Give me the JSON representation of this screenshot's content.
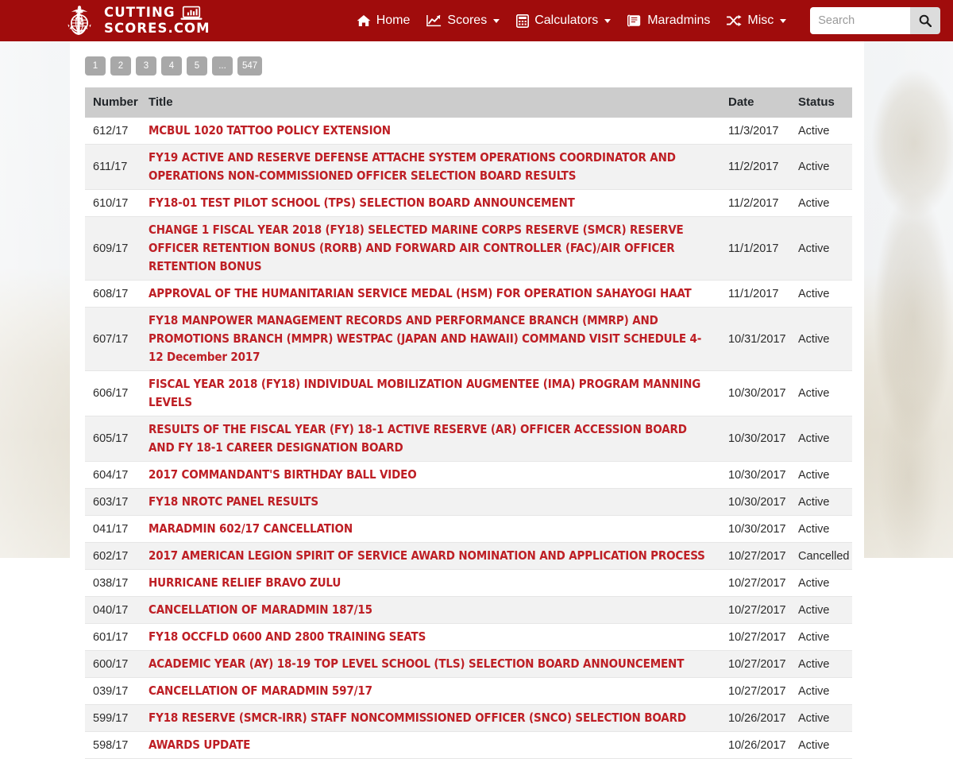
{
  "brand": {
    "line1": "CUTTING",
    "line2": "SCORES.COM",
    "emblem_icon": "marine-corps-ega-icon",
    "laptop_icon": "laptop-chart-icon"
  },
  "nav": {
    "items": [
      {
        "label": "Home",
        "icon": "home-icon",
        "caret": false
      },
      {
        "label": "Scores",
        "icon": "chart-line-icon",
        "caret": true
      },
      {
        "label": "Calculators",
        "icon": "calculator-icon",
        "caret": true
      },
      {
        "label": "Maradmins",
        "icon": "book-icon",
        "caret": false
      },
      {
        "label": "Misc",
        "icon": "shuffle-icon",
        "caret": true
      }
    ]
  },
  "search": {
    "placeholder": "Search",
    "value": "",
    "button_icon": "search-icon"
  },
  "pagination": {
    "pages": [
      "1",
      "2",
      "3",
      "4",
      "5",
      "...",
      "547"
    ],
    "active": "1"
  },
  "colors": {
    "header_red": "#a00c0c",
    "link_red": "#be1f25",
    "table_header_gray": "#cccccc",
    "pagination_gray": "#a8a8a8",
    "row_alt_gray": "#f2f2f2"
  },
  "table": {
    "columns": [
      "Number",
      "Title",
      "Date",
      "Status"
    ],
    "rows": [
      {
        "number": "612/17",
        "title": "MCBUL 1020 TATTOO POLICY EXTENSION",
        "date": "11/3/2017",
        "status": "Active"
      },
      {
        "number": "611/17",
        "title": "FY19 ACTIVE AND RESERVE DEFENSE ATTACHE SYSTEM OPERATIONS COORDINATOR AND OPERATIONS NON-COMMISSIONED OFFICER SELECTION BOARD RESULTS",
        "date": "11/2/2017",
        "status": "Active"
      },
      {
        "number": "610/17",
        "title": "FY18-01 TEST PILOT SCHOOL (TPS) SELECTION BOARD ANNOUNCEMENT",
        "date": "11/2/2017",
        "status": "Active"
      },
      {
        "number": "609/17",
        "title": "CHANGE 1 FISCAL YEAR 2018 (FY18) SELECTED MARINE CORPS RESERVE (SMCR) RESERVE OFFICER RETENTION BONUS (RORB) AND FORWARD AIR CONTROLLER (FAC)/AIR OFFICER RETENTION BONUS",
        "date": "11/1/2017",
        "status": "Active"
      },
      {
        "number": "608/17",
        "title": "APPROVAL OF THE HUMANITARIAN SERVICE MEDAL (HSM) FOR OPERATION SAHAYOGI HAAT",
        "date": "11/1/2017",
        "status": "Active"
      },
      {
        "number": "607/17",
        "title": "FY18 MANPOWER MANAGEMENT RECORDS AND PERFORMANCE BRANCH (MMRP) AND PROMOTIONS BRANCH (MMPR) WESTPAC (JAPAN AND HAWAII) COMMAND VISIT SCHEDULE 4-12 December 2017",
        "date": "10/31/2017",
        "status": "Active"
      },
      {
        "number": "606/17",
        "title": "FISCAL YEAR 2018 (FY18) INDIVIDUAL MOBILIZATION AUGMENTEE (IMA) PROGRAM MANNING LEVELS",
        "date": "10/30/2017",
        "status": "Active"
      },
      {
        "number": "605/17",
        "title": "RESULTS OF THE FISCAL YEAR (FY) 18-1 ACTIVE RESERVE (AR) OFFICER ACCESSION BOARD AND FY 18-1 CAREER DESIGNATION BOARD",
        "date": "10/30/2017",
        "status": "Active"
      },
      {
        "number": "604/17",
        "title": "2017 COMMANDANT'S BIRTHDAY BALL VIDEO",
        "date": "10/30/2017",
        "status": "Active"
      },
      {
        "number": "603/17",
        "title": "FY18 NROTC PANEL RESULTS",
        "date": "10/30/2017",
        "status": "Active"
      },
      {
        "number": "041/17",
        "title": "MARADMIN 602/17 CANCELLATION",
        "date": "10/30/2017",
        "status": "Active"
      },
      {
        "number": "602/17",
        "title": "2017 AMERICAN LEGION SPIRIT OF SERVICE AWARD NOMINATION AND APPLICATION PROCESS",
        "date": "10/27/2017",
        "status": "Cancelled"
      },
      {
        "number": "038/17",
        "title": "HURRICANE RELIEF BRAVO ZULU",
        "date": "10/27/2017",
        "status": "Active"
      },
      {
        "number": "040/17",
        "title": "CANCELLATION OF MARADMIN 187/15",
        "date": "10/27/2017",
        "status": "Active"
      },
      {
        "number": "601/17",
        "title": "FY18 OCCFLD 0600 AND 2800 TRAINING SEATS",
        "date": "10/27/2017",
        "status": "Active"
      },
      {
        "number": "600/17",
        "title": "ACADEMIC YEAR (AY) 18-19 TOP LEVEL SCHOOL (TLS) SELECTION BOARD ANNOUNCEMENT",
        "date": "10/27/2017",
        "status": "Active"
      },
      {
        "number": "039/17",
        "title": "CANCELLATION OF MARADMIN 597/17",
        "date": "10/27/2017",
        "status": "Active"
      },
      {
        "number": "599/17",
        "title": "FY18 RESERVE (SMCR-IRR) STAFF NONCOMMISSIONED OFFICER (SNCO) SELECTION BOARD",
        "date": "10/26/2017",
        "status": "Active"
      },
      {
        "number": "598/17",
        "title": "AWARDS UPDATE",
        "date": "10/26/2017",
        "status": "Active"
      }
    ]
  }
}
